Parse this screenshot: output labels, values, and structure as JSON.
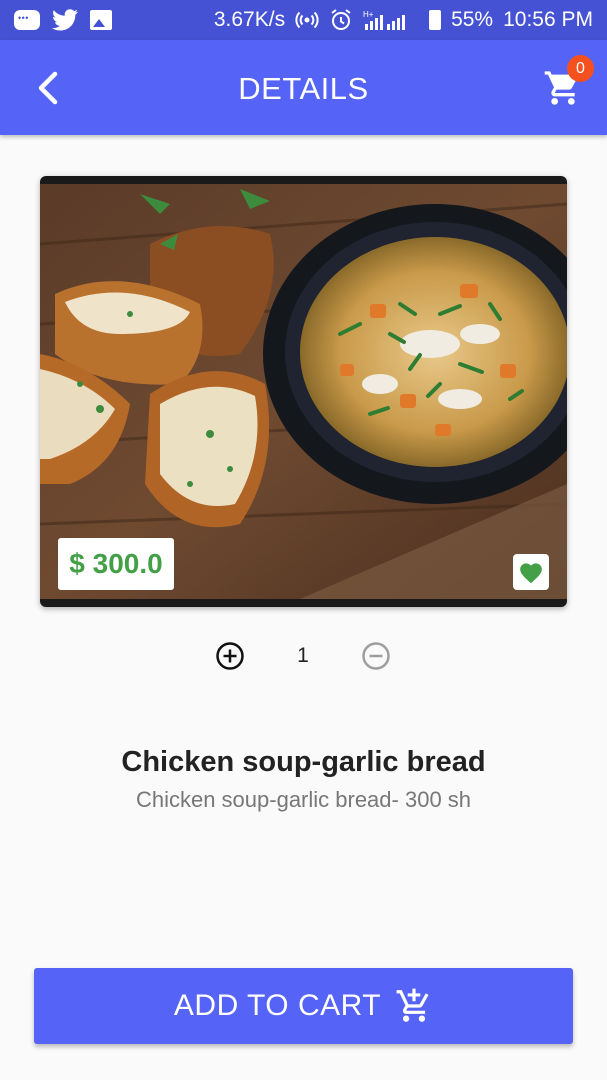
{
  "status_bar": {
    "network_speed": "3.67K/s",
    "battery": "55%",
    "time": "10:56 PM",
    "icons": [
      "message-icon",
      "twitter-icon",
      "image-icon",
      "hotspot-icon",
      "alarm-icon",
      "signal-icon",
      "battery-icon"
    ]
  },
  "app_bar": {
    "title": "DETAILS",
    "back_icon": "chevron-left-icon",
    "cart_icon": "cart-icon",
    "cart_count": "0",
    "colors": {
      "app_bar": "#5563f6",
      "status_bar": "#4552d3",
      "badge": "#f4511e"
    }
  },
  "product": {
    "price": "$ 300.0",
    "price_color": "#43a047",
    "favorite_icon": "heart-icon",
    "quantity": "1",
    "name": "Chicken soup-garlic bread",
    "description": "Chicken soup-garlic bread- 300 sh"
  },
  "actions": {
    "add_to_cart": "ADD TO CART",
    "add_to_cart_icon": "add-shopping-cart-icon"
  }
}
